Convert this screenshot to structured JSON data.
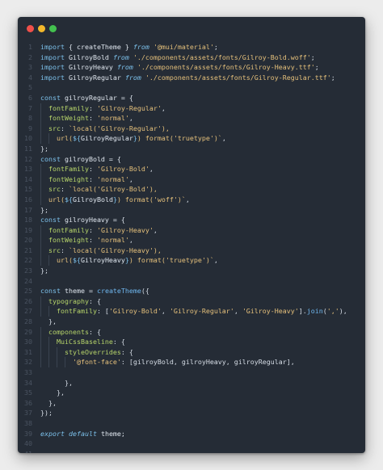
{
  "window": {
    "buttons": [
      "close",
      "minimize",
      "maximize"
    ]
  },
  "colors": {
    "background": "#252c36",
    "keyword": "#7cc0ea",
    "string": "#e5c07b",
    "function": "#6fb7ef",
    "property": "#b7d56a",
    "line_number": "#4a5361"
  },
  "code_lines": [
    [
      {
        "t": "import",
        "c": "kw"
      },
      {
        "t": " { createTheme } ",
        "c": "var"
      },
      {
        "t": "from",
        "c": "kw-i"
      },
      {
        "t": " ",
        "c": "var"
      },
      {
        "t": "'@mui/material'",
        "c": "str"
      },
      {
        "t": ";",
        "c": "punc"
      }
    ],
    [
      {
        "t": "import",
        "c": "kw"
      },
      {
        "t": " GilroyBold ",
        "c": "var"
      },
      {
        "t": "from",
        "c": "kw-i"
      },
      {
        "t": " ",
        "c": "var"
      },
      {
        "t": "'./components/assets/fonts/Gilroy-Bold.woff'",
        "c": "str"
      },
      {
        "t": ";",
        "c": "punc"
      }
    ],
    [
      {
        "t": "import",
        "c": "kw"
      },
      {
        "t": " GilroyHeavy ",
        "c": "var"
      },
      {
        "t": "from",
        "c": "kw-i"
      },
      {
        "t": " ",
        "c": "var"
      },
      {
        "t": "'./components/assets/fonts/Gilroy-Heavy.ttf'",
        "c": "str"
      },
      {
        "t": ";",
        "c": "punc"
      }
    ],
    [
      {
        "t": "import",
        "c": "kw"
      },
      {
        "t": " GilroyRegular ",
        "c": "var"
      },
      {
        "t": "from",
        "c": "kw-i"
      },
      {
        "t": " ",
        "c": "var"
      },
      {
        "t": "'./components/assets/fonts/Gilroy-Regular.ttf'",
        "c": "str"
      },
      {
        "t": ";",
        "c": "punc"
      }
    ],
    [],
    [
      {
        "t": "const",
        "c": "kw"
      },
      {
        "t": " gilroyRegular = {",
        "c": "var"
      }
    ],
    [
      {
        "t": "  ",
        "c": "var"
      },
      {
        "t": "fontFamily",
        "c": "prop"
      },
      {
        "t": ": ",
        "c": "punc"
      },
      {
        "t": "'Gilroy-Regular'",
        "c": "str"
      },
      {
        "t": ",",
        "c": "punc"
      }
    ],
    [
      {
        "t": "  ",
        "c": "var"
      },
      {
        "t": "fontWeight",
        "c": "prop"
      },
      {
        "t": ": ",
        "c": "punc"
      },
      {
        "t": "'normal'",
        "c": "str"
      },
      {
        "t": ",",
        "c": "punc"
      }
    ],
    [
      {
        "t": "  ",
        "c": "var"
      },
      {
        "t": "src",
        "c": "prop"
      },
      {
        "t": ": ",
        "c": "punc"
      },
      {
        "t": "`local('Gilroy-Regular'),",
        "c": "str"
      }
    ],
    [
      {
        "t": "    ",
        "c": "var"
      },
      {
        "t": "url(",
        "c": "str"
      },
      {
        "t": "${",
        "c": "kw"
      },
      {
        "t": "GilroyRegular",
        "c": "var"
      },
      {
        "t": "}",
        "c": "kw"
      },
      {
        "t": ") format('truetype')`",
        "c": "str"
      },
      {
        "t": ",",
        "c": "punc"
      }
    ],
    [
      {
        "t": "};",
        "c": "punc"
      }
    ],
    [
      {
        "t": "const",
        "c": "kw"
      },
      {
        "t": " gilroyBold = {",
        "c": "var"
      }
    ],
    [
      {
        "t": "  ",
        "c": "var"
      },
      {
        "t": "fontFamily",
        "c": "prop"
      },
      {
        "t": ": ",
        "c": "punc"
      },
      {
        "t": "'Gilroy-Bold'",
        "c": "str"
      },
      {
        "t": ",",
        "c": "punc"
      }
    ],
    [
      {
        "t": "  ",
        "c": "var"
      },
      {
        "t": "fontWeight",
        "c": "prop"
      },
      {
        "t": ": ",
        "c": "punc"
      },
      {
        "t": "'normal'",
        "c": "str"
      },
      {
        "t": ",",
        "c": "punc"
      }
    ],
    [
      {
        "t": "  ",
        "c": "var"
      },
      {
        "t": "src",
        "c": "prop"
      },
      {
        "t": ": ",
        "c": "punc"
      },
      {
        "t": "`local('Gilroy-Bold'),",
        "c": "str"
      }
    ],
    [
      {
        "t": "  ",
        "c": "var"
      },
      {
        "t": "url(",
        "c": "str"
      },
      {
        "t": "${",
        "c": "kw"
      },
      {
        "t": "GilroyBold",
        "c": "var"
      },
      {
        "t": "}",
        "c": "kw"
      },
      {
        "t": ") format('woff')`",
        "c": "str"
      },
      {
        "t": ",",
        "c": "punc"
      }
    ],
    [
      {
        "t": "};",
        "c": "punc"
      }
    ],
    [
      {
        "t": "const",
        "c": "kw"
      },
      {
        "t": " gilroyHeavy = {",
        "c": "var"
      }
    ],
    [
      {
        "t": "  ",
        "c": "var"
      },
      {
        "t": "fontFamily",
        "c": "prop"
      },
      {
        "t": ": ",
        "c": "punc"
      },
      {
        "t": "'Gilroy-Heavy'",
        "c": "str"
      },
      {
        "t": ",",
        "c": "punc"
      }
    ],
    [
      {
        "t": "  ",
        "c": "var"
      },
      {
        "t": "fontWeight",
        "c": "prop"
      },
      {
        "t": ": ",
        "c": "punc"
      },
      {
        "t": "'normal'",
        "c": "str"
      },
      {
        "t": ",",
        "c": "punc"
      }
    ],
    [
      {
        "t": "  ",
        "c": "var"
      },
      {
        "t": "src",
        "c": "prop"
      },
      {
        "t": ": ",
        "c": "punc"
      },
      {
        "t": "`local('Gilroy-Heavy'),",
        "c": "str"
      }
    ],
    [
      {
        "t": "    ",
        "c": "var"
      },
      {
        "t": "url(",
        "c": "str"
      },
      {
        "t": "${",
        "c": "kw"
      },
      {
        "t": "GilroyHeavy",
        "c": "var"
      },
      {
        "t": "}",
        "c": "kw"
      },
      {
        "t": ") format('truetype')`",
        "c": "str"
      },
      {
        "t": ",",
        "c": "punc"
      }
    ],
    [
      {
        "t": "};",
        "c": "punc"
      }
    ],
    [],
    [
      {
        "t": "const",
        "c": "kw"
      },
      {
        "t": " theme = ",
        "c": "var"
      },
      {
        "t": "createTheme",
        "c": "fn"
      },
      {
        "t": "({",
        "c": "punc"
      }
    ],
    [
      {
        "t": "  ",
        "c": "var"
      },
      {
        "t": "typography",
        "c": "prop"
      },
      {
        "t": ": {",
        "c": "punc"
      }
    ],
    [
      {
        "t": "    ",
        "c": "var"
      },
      {
        "t": "fontFamily",
        "c": "prop"
      },
      {
        "t": ": [",
        "c": "punc"
      },
      {
        "t": "'Gilroy-Bold'",
        "c": "str"
      },
      {
        "t": ", ",
        "c": "punc"
      },
      {
        "t": "'Gilroy-Regular'",
        "c": "str"
      },
      {
        "t": ", ",
        "c": "punc"
      },
      {
        "t": "'Gilroy-Heavy'",
        "c": "str"
      },
      {
        "t": "].",
        "c": "punc"
      },
      {
        "t": "join",
        "c": "fn"
      },
      {
        "t": "(",
        "c": "punc"
      },
      {
        "t": "','",
        "c": "str"
      },
      {
        "t": "),",
        "c": "punc"
      }
    ],
    [
      {
        "t": "  },",
        "c": "punc"
      }
    ],
    [
      {
        "t": "  ",
        "c": "var"
      },
      {
        "t": "components",
        "c": "prop"
      },
      {
        "t": ": {",
        "c": "punc"
      }
    ],
    [
      {
        "t": "    ",
        "c": "var"
      },
      {
        "t": "MuiCssBaseline",
        "c": "prop"
      },
      {
        "t": ": {",
        "c": "punc"
      }
    ],
    [
      {
        "t": "      ",
        "c": "var"
      },
      {
        "t": "styleOverrides",
        "c": "prop"
      },
      {
        "t": ": {",
        "c": "punc"
      }
    ],
    [
      {
        "t": "        ",
        "c": "var"
      },
      {
        "t": "'@font-face'",
        "c": "str"
      },
      {
        "t": ": [gilroyBold, gilroyHeavy, gilroyRegular],",
        "c": "punc"
      }
    ],
    [],
    [
      {
        "t": "      },",
        "c": "punc"
      }
    ],
    [
      {
        "t": "    },",
        "c": "punc"
      }
    ],
    [
      {
        "t": "  },",
        "c": "punc"
      }
    ],
    [
      {
        "t": "});",
        "c": "punc"
      }
    ],
    [],
    [
      {
        "t": "export",
        "c": "kw-i"
      },
      {
        "t": " ",
        "c": "var"
      },
      {
        "t": "default",
        "c": "kw-i"
      },
      {
        "t": " theme;",
        "c": "var"
      }
    ],
    [],
    []
  ]
}
